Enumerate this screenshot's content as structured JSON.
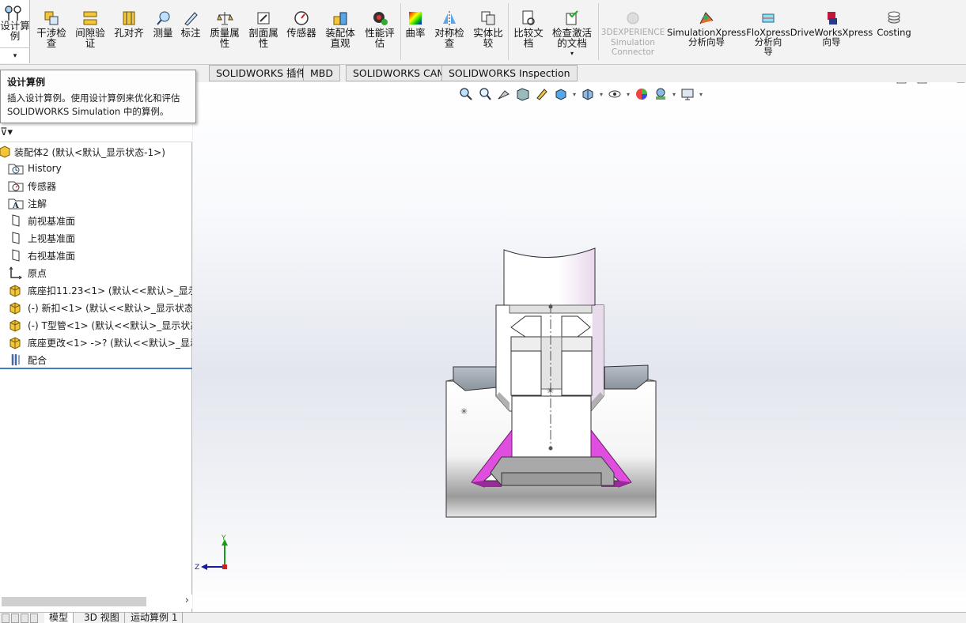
{
  "ribbon": {
    "first_label": "设计算\n例",
    "items": [
      {
        "label": "干涉检\n查",
        "icon": "interference-check-icon"
      },
      {
        "label": "间隙验\n证",
        "icon": "clearance-verify-icon"
      },
      {
        "label": "孔对齐",
        "icon": "hole-align-icon"
      },
      {
        "label": "测量",
        "icon": "measure-icon"
      },
      {
        "label": "标注",
        "icon": "markup-icon"
      },
      {
        "label": "质量属\n性",
        "icon": "mass-properties-icon"
      },
      {
        "label": "剖面属\n性",
        "icon": "section-properties-icon"
      },
      {
        "label": "传感器",
        "icon": "sensor-icon"
      },
      {
        "label": "装配体\n直观",
        "icon": "assembly-visualization-icon"
      },
      {
        "label": "性能评\n估",
        "icon": "performance-evaluation-icon"
      },
      {
        "label": "曲率",
        "icon": "curvature-icon"
      },
      {
        "label": "对称检\n查",
        "icon": "symmetry-check-icon"
      },
      {
        "label": "实体比\n较",
        "icon": "compare-body-icon"
      },
      {
        "label": "比较文\n档",
        "icon": "compare-documents-icon"
      },
      {
        "label": "检查激活\n的文档",
        "icon": "check-active-document-icon"
      },
      {
        "label": "3DEXPERIENCE\nSimulation\nConnector",
        "icon": "3dexperience-icon"
      },
      {
        "label": "SimulationXpress\n分析向导",
        "icon": "simulationxpress-icon"
      },
      {
        "label": "FloXpress\n分析向\n导",
        "icon": "floxpress-icon"
      },
      {
        "label": "DriveWorksXpress\n向导",
        "icon": "driveworksxpress-icon"
      },
      {
        "label": "Costing",
        "icon": "costing-icon"
      }
    ]
  },
  "tabs": [
    "SOLIDWORKS 插件",
    "MBD",
    "SOLIDWORKS CAM",
    "SOLIDWORKS Inspection"
  ],
  "tooltip": {
    "title": "设计算例",
    "line1": "插入设计算例。使用设计算例来优化和评估",
    "line2": "SOLIDWORKS Simulation 中的算例。"
  },
  "tree": {
    "root": "装配体2  (默认<默认_显示状态-1>)",
    "items": [
      {
        "label": "History",
        "icon": "history-folder-icon"
      },
      {
        "label": "传感器",
        "icon": "sensor-folder-icon"
      },
      {
        "label": "注解",
        "icon": "annotation-icon"
      },
      {
        "label": "前视基准面",
        "icon": "plane-icon"
      },
      {
        "label": "上视基准面",
        "icon": "plane-icon"
      },
      {
        "label": "右视基准面",
        "icon": "plane-icon"
      },
      {
        "label": "原点",
        "icon": "origin-icon"
      },
      {
        "label": "底座扣11.23<1> (默认<<默认>_显示:",
        "icon": "component-icon"
      },
      {
        "label": "(-) 新扣<1> (默认<<默认>_显示状态",
        "icon": "component-icon"
      },
      {
        "label": "(-) T型管<1> (默认<<默认>_显示状态",
        "icon": "component-icon"
      },
      {
        "label": "底座更改<1> ->? (默认<<默认>_显示",
        "icon": "component-icon"
      },
      {
        "label": "配合",
        "icon": "mates-icon"
      }
    ]
  },
  "bottom_tabs": [
    "模型",
    "3D 视图",
    "运动算例 1"
  ],
  "triad": {
    "y": "Y",
    "z": "Z"
  },
  "colors": {
    "accent_blue": "#3d7fc3",
    "magenta_part": "#e04ee0",
    "gray_part": "#a8b0b8"
  }
}
